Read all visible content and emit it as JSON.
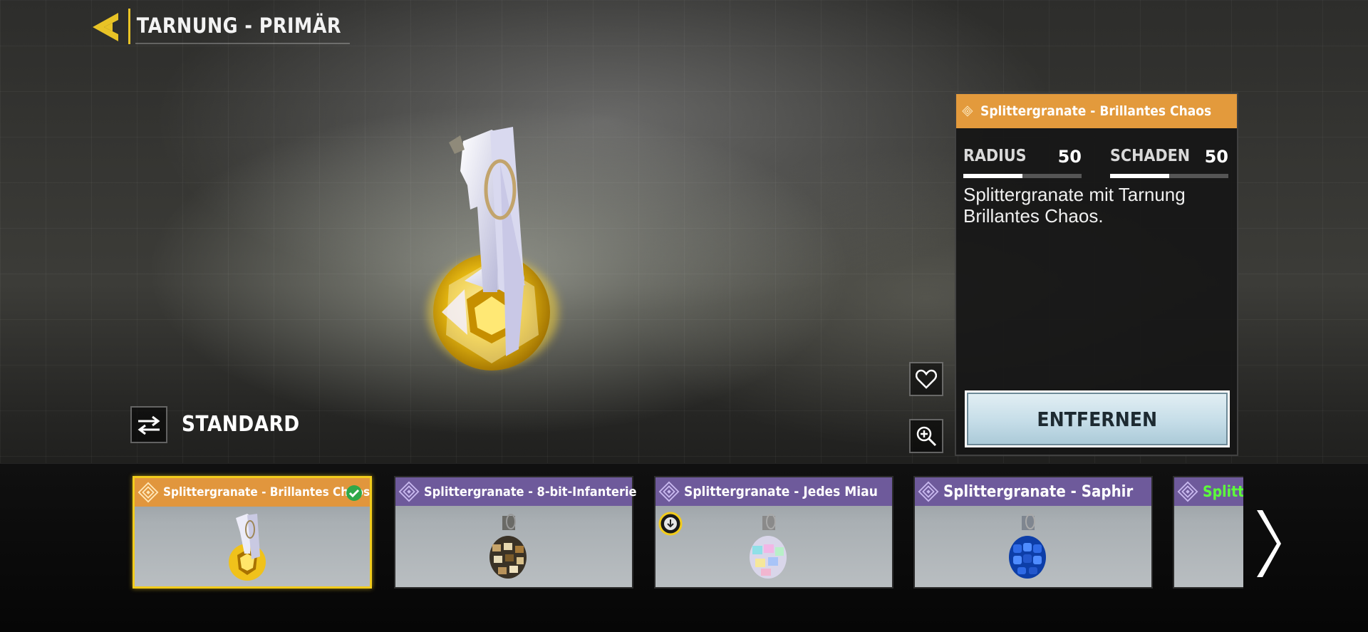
{
  "header": {
    "title": "TARNUNG - PRIMÄR",
    "back_icon": "back-arrow-icon",
    "accent": "#e8c326"
  },
  "preview": {
    "toggle_label": "STANDARD",
    "toggle_icon": "swap-arrows-icon"
  },
  "side_buttons": {
    "favorite_icon": "heart-icon",
    "zoom_icon": "zoom-in-icon"
  },
  "info_panel": {
    "title": "Splittergranate - Brillantes Chaos",
    "header_color": "#e39a3c",
    "stats": [
      {
        "label": "RADIUS",
        "value": "50",
        "fraction": 0.5
      },
      {
        "label": "SCHADEN",
        "value": "50",
        "fraction": 0.5
      }
    ],
    "description": "Splittergranate mit Tarnung Brillantes Chaos.",
    "action_label": "ENTFERNEN"
  },
  "carousel": {
    "items": [
      {
        "title": "Splittergranate - Brillantes Chaos",
        "rarity": "legendary",
        "selected": true,
        "equipped": true
      },
      {
        "title": "Splittergranate - 8-bit-Infanterie",
        "rarity": "epic",
        "selected": false
      },
      {
        "title": "Splittergranate - Jedes Miau",
        "rarity": "epic",
        "selected": false,
        "download_badge": true
      },
      {
        "title": "Splittergranate - Saphir",
        "rarity": "epic",
        "selected": false
      },
      {
        "title": "Splitte",
        "rarity": "epic",
        "selected": false,
        "title_color": "#5dff3a"
      }
    ],
    "next_icon": "chevron-right-icon"
  }
}
